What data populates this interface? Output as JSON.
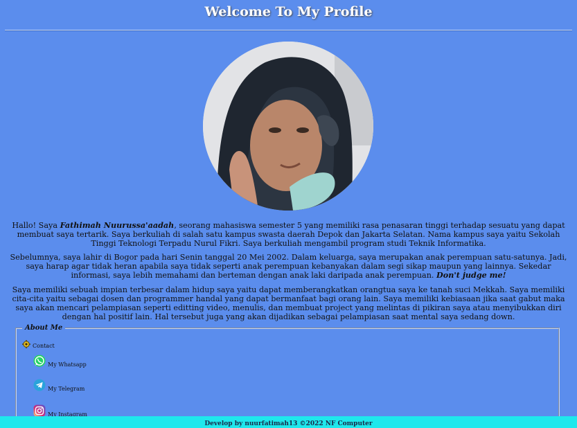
{
  "header": {
    "title": "Welcome To My Profile"
  },
  "intro": {
    "p1_before": "Hallo! Saya ",
    "p1_name": "Fathimah Nuurussa'aadah",
    "p1_after": ", seorang mahasiswa semester 5 yang memiliki rasa penasaran tinggi terhadap sesuatu yang dapat membuat saya tertarik. Saya berkuliah di salah satu kampus swasta daerah Depok dan Jakarta Selatan. Nama kampus saya yaitu Sekolah Tinggi Teknologi Terpadu Nurul Fikri. Saya berkuliah mengambil program studi Teknik Informatika.",
    "p2_text": "Sebelumnya, saya lahir di Bogor pada hari Senin tanggal 20 Mei 2002. Dalam keluarga, saya merupakan anak perempuan satu-satunya. Jadi, saya harap agar tidak heran apabila saya tidak seperti anak perempuan kebanyakan dalam segi sikap maupun yang lainnya. Sekedar informasi, saya lebih memahami dan berteman dengan anak laki daripada anak perempuan. ",
    "p2_emph": "Don't judge me!",
    "p3_text": "Saya memiliki sebuah impian terbesar dalam hidup saya yaitu dapat memberangkatkan orangtua saya ke tanah suci Mekkah. Saya memiliki cita-cita yaitu sebagai dosen dan programmer handal yang dapat bermanfaat bagi orang lain. Saya memiliki kebiasaan jika saat gabut maka saya akan mencari pelampiasan seperti editting video, menulis, dan membuat project yang melintas di pikiran saya atau menyibukkan diri dengan hal positif lain. Hal tersebut juga yang akan dijadikan sebagai pelampiasan saat mental saya sedang down."
  },
  "about": {
    "legend": "About Me",
    "contact_label": "Contact",
    "links": {
      "whatsapp": "My Whatsapp",
      "telegram": "My Telegram",
      "instagram": "My Instagram"
    }
  },
  "footer": {
    "text": "Develop by nuurfatimah13 ©2022 NF Computer"
  },
  "icons": {
    "contact": "contact-gear-icon",
    "whatsapp": "whatsapp-icon",
    "telegram": "telegram-icon",
    "instagram": "instagram-icon"
  },
  "colors": {
    "background": "#5b8ded",
    "footer": "#1fe8ec",
    "whatsapp": "#25d366",
    "telegram": "#2aa3db"
  }
}
